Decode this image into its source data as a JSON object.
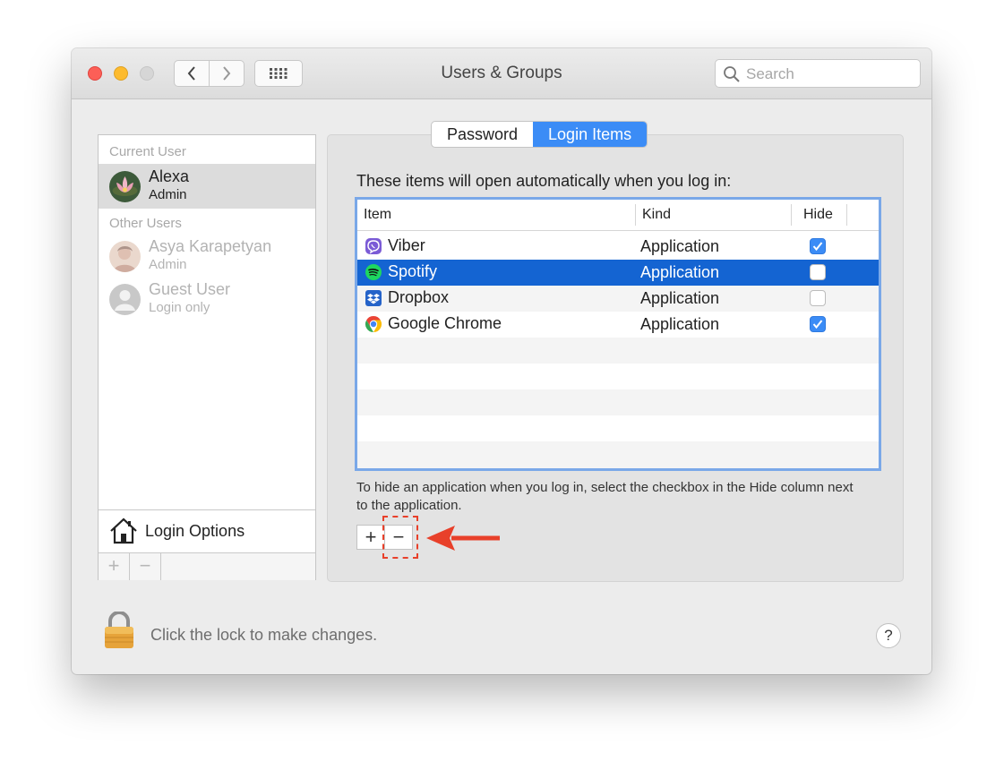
{
  "window": {
    "title": "Users & Groups"
  },
  "search": {
    "placeholder": "Search"
  },
  "sidebar": {
    "current_user_label": "Current User",
    "other_users_label": "Other Users",
    "current_user": {
      "name": "Alexa",
      "role": "Admin"
    },
    "other_users": [
      {
        "name": "Asya Karapetyan",
        "role": "Admin"
      },
      {
        "name": "Guest User",
        "role": "Login only"
      }
    ],
    "login_options_label": "Login Options",
    "add_label": "+",
    "remove_label": "−"
  },
  "tabs": [
    {
      "label": "Password",
      "active": false
    },
    {
      "label": "Login Items",
      "active": true
    }
  ],
  "login_items": {
    "intro": "These items will open automatically when you log in:",
    "columns": {
      "item": "Item",
      "kind": "Kind",
      "hide": "Hide"
    },
    "rows": [
      {
        "name": "Viber",
        "kind": "Application",
        "hide": true,
        "icon": "viber-icon"
      },
      {
        "name": "Spotify",
        "kind": "Application",
        "hide": false,
        "icon": "spotify-icon",
        "selected": true
      },
      {
        "name": "Dropbox",
        "kind": "Application",
        "hide": false,
        "icon": "dropbox-icon"
      },
      {
        "name": "Google Chrome",
        "kind": "Application",
        "hide": true,
        "icon": "chrome-icon"
      }
    ],
    "hint": "To hide an application when you log in, select the checkbox in the Hide column next to the application.",
    "add_label": "+",
    "remove_label": "−"
  },
  "footer": {
    "lock_text": "Click the lock to make changes.",
    "help_label": "?"
  },
  "colors": {
    "accent": "#3b8cf6",
    "selection": "#1464d2",
    "annotation_red": "#e8402a"
  }
}
